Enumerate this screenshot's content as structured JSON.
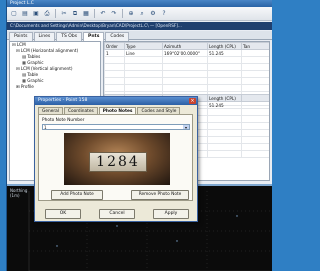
{
  "window": {
    "title": "Project L.C"
  },
  "toolbar": {
    "icons": [
      "new-icon",
      "open-icon",
      "save-icon",
      "print-icon",
      "cut-icon",
      "copy-icon",
      "paste-icon",
      "undo-icon",
      "redo-icon",
      "zoom-icon",
      "search-icon",
      "settings-icon",
      "help-icon"
    ],
    "glyphs": [
      "▢",
      "▤",
      "▣",
      "⎙",
      "✂",
      "⧉",
      "▦",
      "↶",
      "↷",
      "⊕",
      "⌕",
      "⚙",
      "?"
    ]
  },
  "path": {
    "text": "C:\\Documents and Settings\\Admin\\Desktop\\Bryan\\CAD\\ProjectL.C\\ — [OpenRSF]..."
  },
  "tabs": [
    "Points",
    "Lines",
    "TS Obs",
    "Pnts",
    "Codes"
  ],
  "tree": {
    "rows": [
      "LCM",
      "LCM (Horizontal alignment)",
      "Tables",
      "Graphic",
      "LCM (Vertical alignment)",
      "Table",
      "Graphic",
      "Profile"
    ]
  },
  "grid": {
    "columns": [
      "Order",
      "Type",
      "Azimuth",
      "Length (CPL)",
      "Tan"
    ],
    "rows": [
      [
        "1",
        "Line",
        "169°02'00.0000\"",
        "51.245",
        ""
      ]
    ],
    "columns2": [
      "",
      "",
      "Ord Speed",
      "Length (CPL)",
      ""
    ],
    "rows2": [
      [
        "",
        "",
        "",
        "51.245",
        ""
      ]
    ]
  },
  "plot": {
    "label": "Northing\n(1m)"
  },
  "dialog": {
    "title": "Properties - Point 158",
    "tabs": [
      "General",
      "Coordinates",
      "Photo Notes",
      "Codes and Style"
    ],
    "active_tab": "Photo Notes",
    "photo_label": "Photo Note Number",
    "photo_select": "1",
    "photo_number": "1284",
    "add_button": "Add Photo Note",
    "remove_button": "Remove Photo Note",
    "ok_button": "OK",
    "cancel_button": "Cancel",
    "apply_button": "Apply"
  }
}
